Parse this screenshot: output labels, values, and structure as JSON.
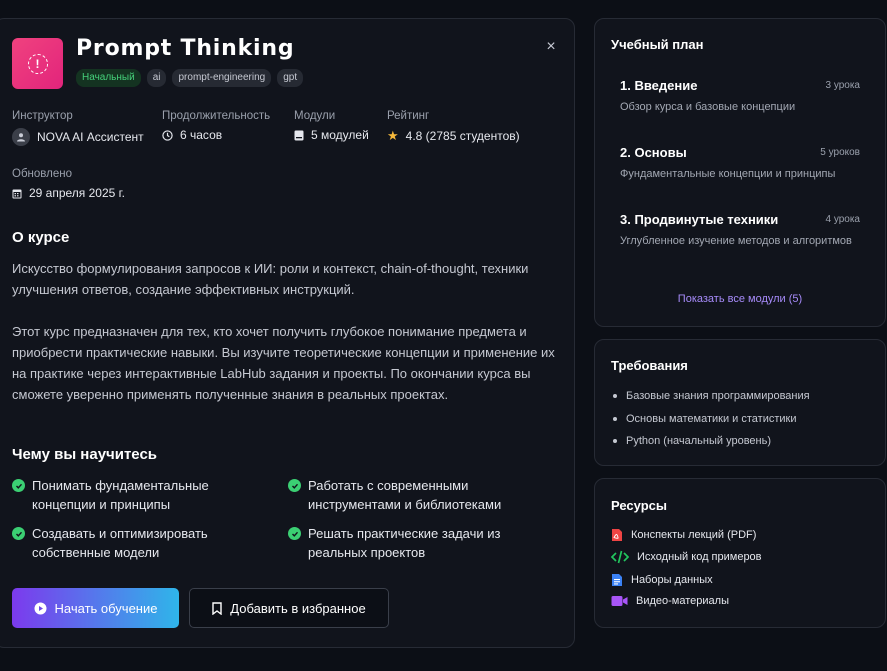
{
  "course": {
    "title": "Prompt Thinking",
    "close_symbol": "×",
    "tags": [
      "Начальный",
      "ai",
      "prompt-engineering",
      "gpt"
    ],
    "level_color": "#45d07a",
    "icon_gradient": [
      "#f0427e",
      "#e2247c"
    ]
  },
  "meta": {
    "instructor_label": "Инструктор",
    "instructor_value": "NOVA AI Ассистент",
    "duration_label": "Продолжительность",
    "duration_value": "6 часов",
    "modules_label": "Модули",
    "modules_value": "5 модулей",
    "rating_label": "Рейтинг",
    "rating_value": "4.8 (2785 студентов)",
    "updated_label": "Обновлено",
    "updated_value": "29 апреля 2025 г."
  },
  "about": {
    "heading": "О курсе",
    "paragraph1": "Искусство формулирования запросов к ИИ: роли и контекст, chain-of-thought, техники улучшения ответов, создание эффективных инструкций.",
    "paragraph2": "Этот курс предназначен для тех, кто хочет получить глубокое понимание предмета и приобрести практические навыки. Вы изучите теоретические концепции и применение их на практике через интерактивные LabHub задания и проекты. По окончании курса вы сможете уверенно применять полученные знания в реальных проектах."
  },
  "learn": {
    "heading": "Чему вы научитесь",
    "items": [
      "Понимать фундаментальные концепции и принципы",
      "Работать с современными инструментами и библиотеками",
      "Создавать и оптимизировать собственные модели",
      "Решать практические задачи из реальных проектов"
    ]
  },
  "actions": {
    "start_label": "Начать обучение",
    "favorite_label": "Добавить в избранное",
    "start_gradient": [
      "#7c3aed",
      "#2fb5ea"
    ]
  },
  "plan": {
    "heading": "Учебный план",
    "items": [
      {
        "title": "1. Введение",
        "count": "3 урока",
        "desc": "Обзор курса и базовые концепции"
      },
      {
        "title": "2. Основы",
        "count": "5 уроков",
        "desc": "Фундаментальные концепции и принципы"
      },
      {
        "title": "3. Продвинутые техники",
        "count": "4 урока",
        "desc": "Углубленное изучение методов и алгоритмов"
      }
    ],
    "show_all": "Показать все модули (5)"
  },
  "requirements": {
    "heading": "Требования",
    "items": [
      "Базовые знания программирования",
      "Основы математики и статистики",
      "Python (начальный уровень)"
    ]
  },
  "resources": {
    "heading": "Ресурсы",
    "items": [
      {
        "label": "Конспекты лекций (PDF)",
        "icon": "pdf-file-icon",
        "color": "#ef4444"
      },
      {
        "label": "Исходный код примеров",
        "icon": "code-icon",
        "color": "#22c55e"
      },
      {
        "label": "Наборы данных",
        "icon": "dataset-file-icon",
        "color": "#3b82f6"
      },
      {
        "label": "Видео-материалы",
        "icon": "video-icon",
        "color": "#a855f7"
      }
    ]
  }
}
